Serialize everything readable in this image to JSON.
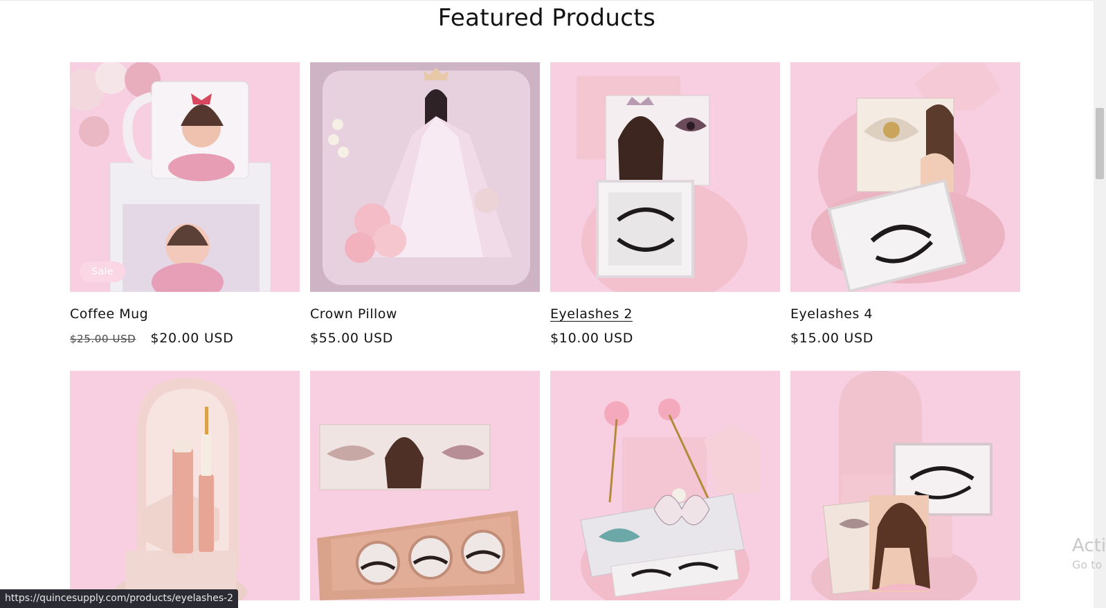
{
  "section": {
    "title": "Featured Products"
  },
  "products": [
    {
      "name": "Coffee Mug",
      "old_price": "$25.00 USD",
      "price": "$20.00 USD",
      "badge": "Sale"
    },
    {
      "name": "Crown Pillow",
      "price": "$55.00 USD"
    },
    {
      "name": "Eyelashes 2",
      "price": "$10.00 USD"
    },
    {
      "name": "Eyelashes 4",
      "price": "$15.00 USD"
    },
    {
      "image": "lash-serum"
    },
    {
      "image": "lash-trio-palette"
    },
    {
      "image": "butterfly-lash-bag"
    },
    {
      "image": "lash-book-stand"
    }
  ],
  "status_bar": {
    "url": "https://quincesupply.com/products/eyelashes-2"
  },
  "watermark": {
    "line1": "Activ",
    "line2": "Go to"
  },
  "colors": {
    "card_background": "#f7cfe0",
    "text": "#121212",
    "badge": "#fbd6e4"
  }
}
